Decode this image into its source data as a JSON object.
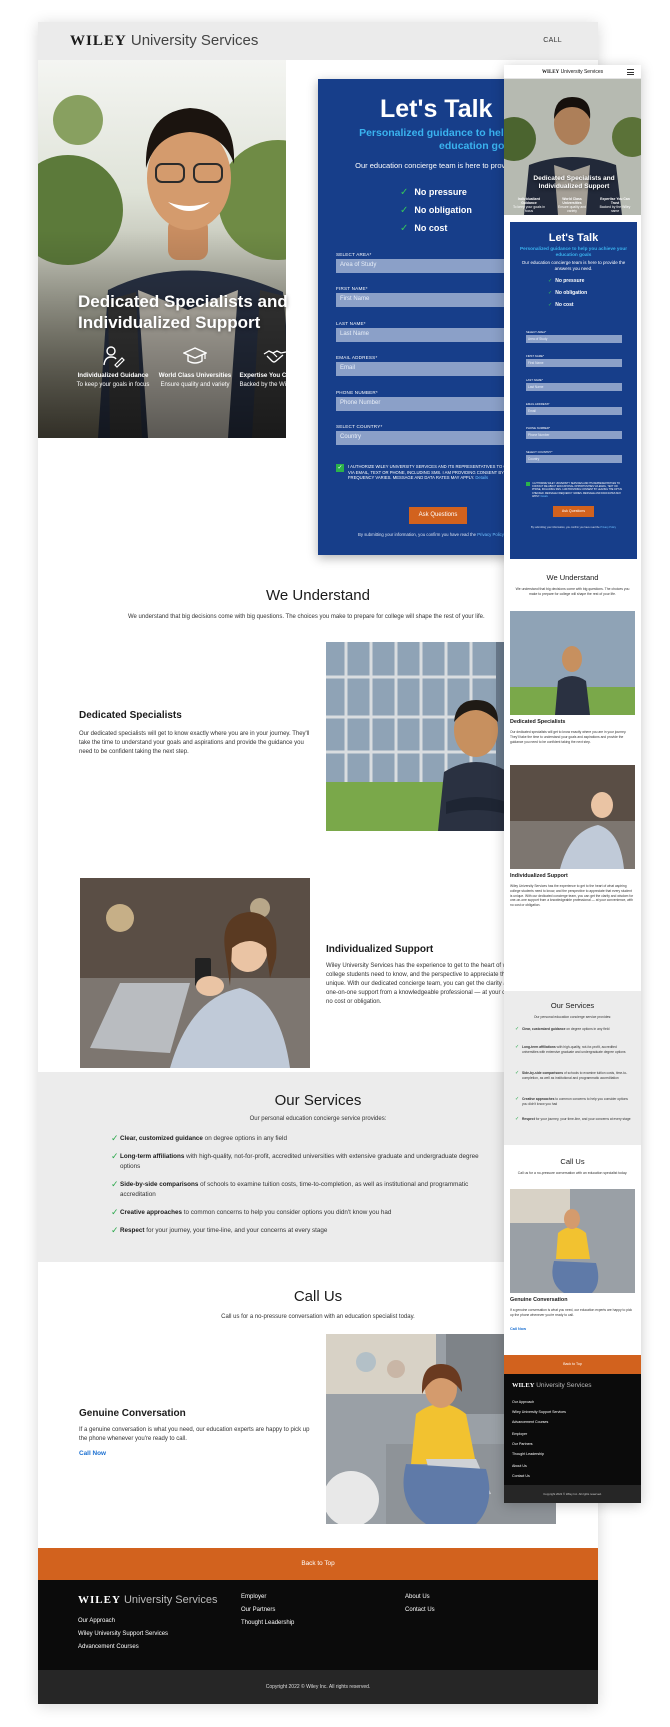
{
  "brand": {
    "wordmark": "WILEY",
    "name": "University Services"
  },
  "header": {
    "call": "CALL"
  },
  "hero": {
    "title": "Dedicated Specialists and Individualized Support",
    "features": [
      {
        "icon": "user-pen-icon",
        "title": "Individualized Guidance",
        "desc": "To keep your goals in focus"
      },
      {
        "icon": "graduation-cap-icon",
        "title": "World Class Universities",
        "desc": "Ensure quality and variety"
      },
      {
        "icon": "handshake-icon",
        "title": "Expertise You Can Trust",
        "desc": "Backed by the Wiley name"
      }
    ]
  },
  "form": {
    "title": "Let's Talk",
    "subtitle": "Personalized guidance to help you achieve your education goals",
    "intro": "Our education concierge team is here to provide the answers you need.",
    "checks": [
      "No pressure",
      "No obligation",
      "No cost"
    ],
    "fields": [
      {
        "label": "SELECT AREA*",
        "value": "Area of Study"
      },
      {
        "label": "FIRST NAME*",
        "value": "First Name"
      },
      {
        "label": "LAST NAME*",
        "value": "Last Name"
      },
      {
        "label": "EMAIL ADDRESS*",
        "value": "Email"
      },
      {
        "label": "PHONE NUMBER*",
        "value": "Phone Number"
      },
      {
        "label": "SELECT COUNTRY*",
        "value": "Country"
      }
    ],
    "consent": "I AUTHORIZE WILEY UNIVERSITY SERVICES AND ITS REPRESENTATIVES TO CONTACT ME ABOUT EDUCATIONAL OPPORTUNITIES VIA EMAIL, TEXT OR PHONE, INCLUDING SMS. I AM PROVIDING CONSENT BY LEAVING THE OPT-IN CHECKED. MESSAGE FREQUENCY VARIES. MESSAGE AND DATA RATES MAY APPLY.",
    "consent_link": "Details",
    "button": "Ask Questions",
    "submit_note": "By submitting your information, you confirm you have read the",
    "submit_link": "Privacy Policy"
  },
  "understand": {
    "title": "We Understand",
    "subtitle": "We understand that big decisions come with big questions. The choices you make to prepare for college will shape the rest of your life."
  },
  "specialists": {
    "title": "Dedicated Specialists",
    "body": "Our dedicated specialists will get to know exactly where you are in your journey. They'll take the time to understand your goals and aspirations and provide the guidance you need to be confident taking the next step."
  },
  "support": {
    "title": "Individualized Support",
    "body": "Wiley University Services has the experience to get to the heart of what aspiring college students need to know, and the perspective to appreciate that every student is unique. With our dedicated concierge team, you can get the clarity and wisdom for one-on-one support from a knowledgeable professional — at your convenience, with no cost or obligation."
  },
  "services": {
    "title": "Our Services",
    "subtitle": "Our personal education concierge service provides:",
    "items": [
      {
        "bold": "Clear, customized guidance",
        "rest": " on degree options in any field"
      },
      {
        "bold": "Long-term affiliations",
        "rest": " with high-quality, not-for-profit, accredited universities with extensive graduate and undergraduate degree options"
      },
      {
        "bold": "Side-by-side comparisons",
        "rest": " of schools to examine tuition costs, time-to-completion, as well as institutional and programmatic accreditation"
      },
      {
        "bold": "Creative approaches",
        "rest": " to common concerns to help you consider options you didn't know you had"
      },
      {
        "bold": "Respect",
        "rest": " for your journey, your time-line, and your concerns at every stage"
      }
    ]
  },
  "callus": {
    "title": "Call Us",
    "subtitle": "Call us for a no-pressure conversation with an education specialist today.",
    "block_title": "Genuine Conversation",
    "block_body": "If a genuine conversation is what you need, our education experts are happy to pick up the phone whenever you're ready to call.",
    "link": "Call Now"
  },
  "footer": {
    "back_to_top": "Back to Top",
    "col1": [
      "Our Approach",
      "Wiley University Support Services",
      "Advancement Courses"
    ],
    "col2": [
      "Employer",
      "Our Partners",
      "Thought Leadership"
    ],
    "col3": [
      "About Us",
      "Contact Us"
    ],
    "copyright": "Copyright 2022 © Wiley Inc. All rights reserved."
  },
  "colors": {
    "navy": "#173e8a",
    "orange": "#d2621e",
    "sky": "#3ab3ef",
    "green": "#2aa84a",
    "footer": "#0b0b0b"
  }
}
